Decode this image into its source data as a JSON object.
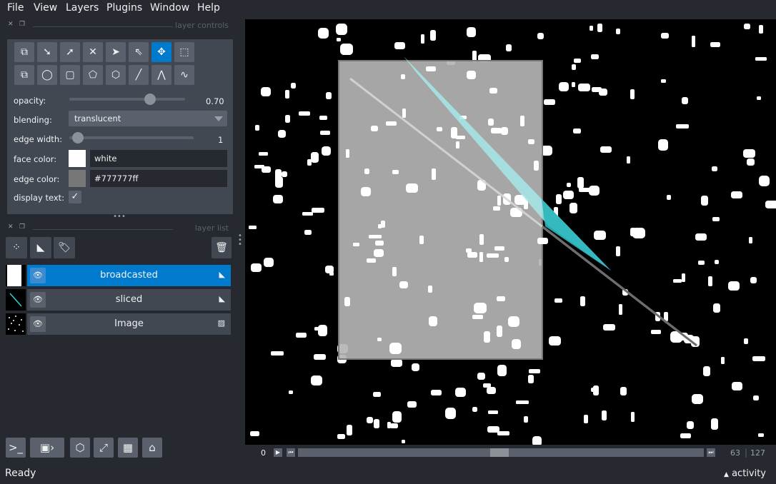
{
  "menu": [
    {
      "label": "File"
    },
    {
      "label": "View"
    },
    {
      "label": "Layers"
    },
    {
      "label": "Plugins"
    },
    {
      "label": "Window"
    },
    {
      "label": "Help"
    }
  ],
  "layer_controls": {
    "title": "layer controls",
    "opacity_label": "opacity:",
    "opacity_value": "0.70",
    "opacity_fraction": 0.7,
    "blending_label": "blending:",
    "blending_value": "translucent",
    "edge_width_label": "edge width:",
    "edge_width_value": "1",
    "face_color_label": "face color:",
    "face_color_value": "white",
    "face_color_hex": "#ffffff",
    "edge_color_label": "edge color:",
    "edge_color_value": "#777777ff",
    "edge_color_hex": "#777777",
    "display_text_label": "display text:",
    "display_text_checked": true
  },
  "layer_list": {
    "title": "layer list",
    "layers": [
      {
        "name": "broadcasted",
        "type_icon": "shapes-icon",
        "selected": true
      },
      {
        "name": "sliced",
        "type_icon": "shapes-icon",
        "selected": false
      },
      {
        "name": "Image",
        "type_icon": "image-icon",
        "selected": false
      }
    ]
  },
  "dims": {
    "current": "0",
    "slice_value": "63",
    "slice_max": "127"
  },
  "status": {
    "text": "Ready",
    "activity_label": "activity"
  },
  "colors": {
    "accent": "#007ACC",
    "panel": "#414851",
    "background": "#262930",
    "canvas": "#000000",
    "shape_face": "#b4b4b4",
    "line_cyan": "#a6e8ea"
  }
}
